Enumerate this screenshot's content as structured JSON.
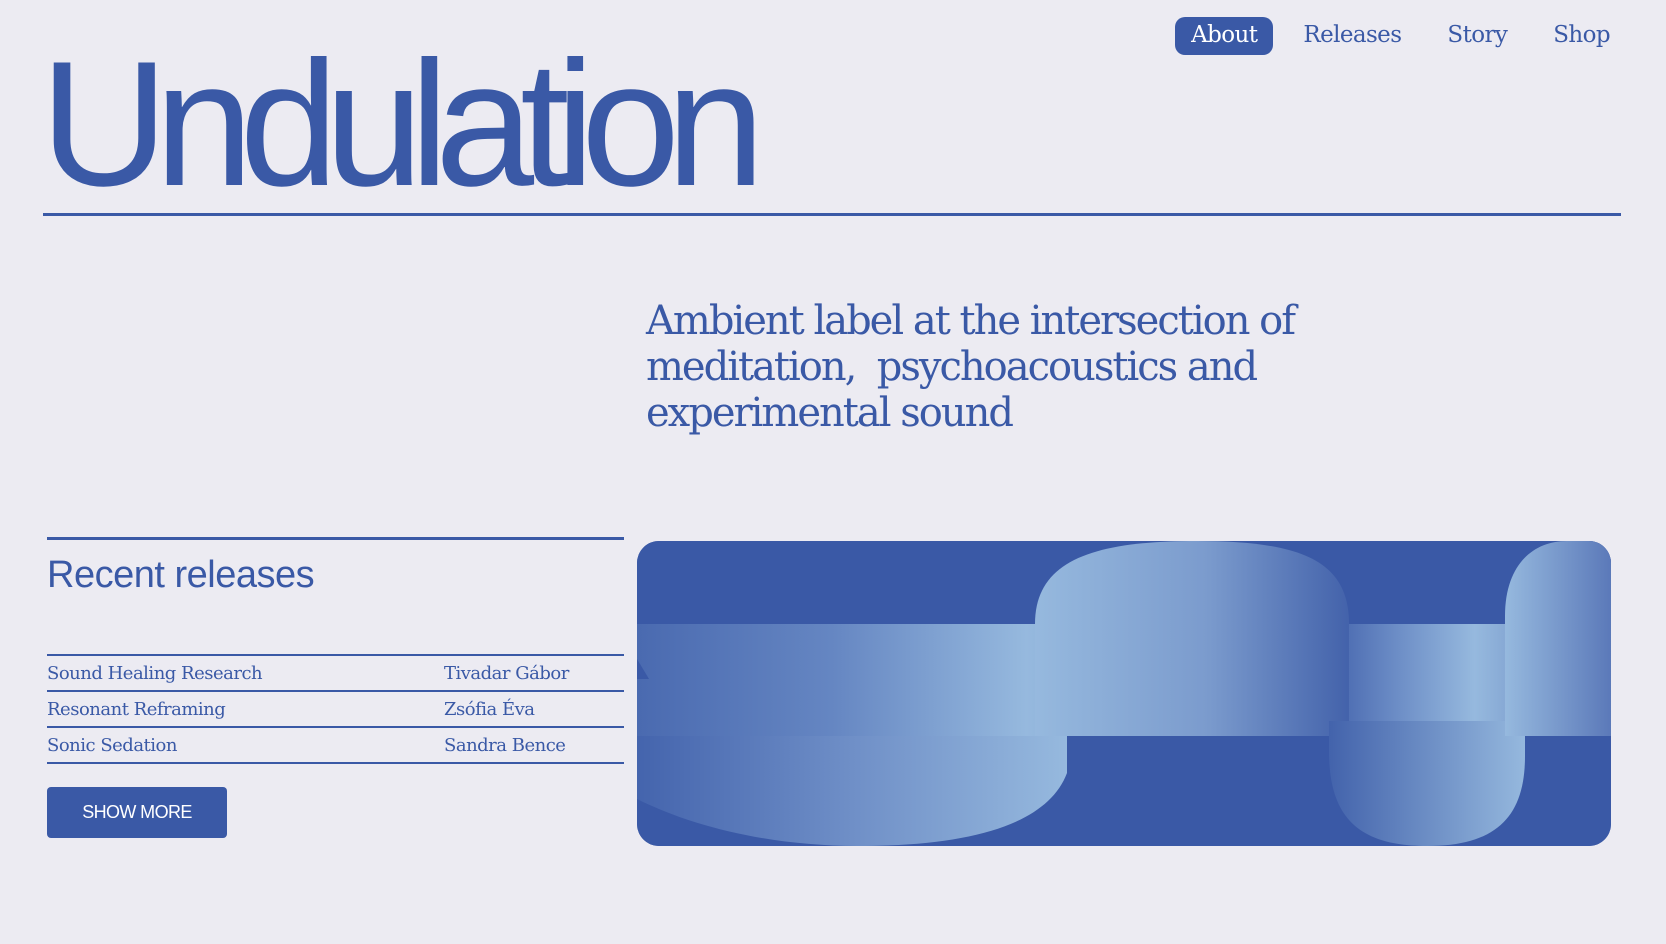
{
  "nav": {
    "items": [
      {
        "label": "About",
        "active": true
      },
      {
        "label": "Releases",
        "active": false
      },
      {
        "label": "Story",
        "active": false
      },
      {
        "label": "Shop",
        "active": false
      }
    ]
  },
  "brand": {
    "name": "Undulation"
  },
  "hero": {
    "tagline_line1": "Ambient label at the intersection of",
    "tagline_line2": "meditation,  psychoacoustics and",
    "tagline_line3": "experimental sound"
  },
  "releases": {
    "heading": "Recent releases",
    "items": [
      {
        "title": "Sound Healing Research",
        "artist": "Tivadar Gábor"
      },
      {
        "title": "Resonant Reframing",
        "artist": "Zsófia Éva"
      },
      {
        "title": "Sonic Sedation",
        "artist": "Sandra Bence"
      }
    ],
    "show_more_label": "SHOW MORE"
  },
  "theme": {
    "primary": "#3a59a6",
    "background": "#ecebf2",
    "light_accent": "#96b9de"
  }
}
